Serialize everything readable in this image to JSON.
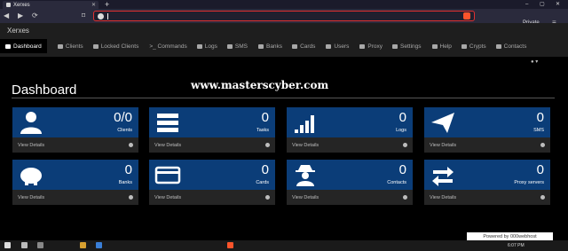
{
  "browser": {
    "tab_title": "Xerxes",
    "tab_close": "✕",
    "new_tab": "+",
    "nav": {
      "back": "◀",
      "forward": "▶",
      "reload": "⟳",
      "bookmark": "⌑"
    },
    "private_label": "Private",
    "menu": "≡",
    "window_controls": {
      "minimize": "–",
      "maximize": "▢",
      "close": "✕"
    }
  },
  "app": {
    "brand": "Xerxes",
    "nav_items": [
      {
        "label": "Dashboard",
        "icon": "dashboard-icon"
      },
      {
        "label": "Clients",
        "icon": "users-icon"
      },
      {
        "label": "Locked Clients",
        "icon": "lock-users-icon"
      },
      {
        "label": ">_ Commands",
        "icon": "terminal-icon"
      },
      {
        "label": "Logs",
        "icon": "logs-icon"
      },
      {
        "label": "SMS",
        "icon": "sms-icon"
      },
      {
        "label": "Banks",
        "icon": "bank-icon"
      },
      {
        "label": "Cards",
        "icon": "cards-icon"
      },
      {
        "label": "Users",
        "icon": "users-icon"
      },
      {
        "label": "Proxy",
        "icon": "proxy-icon"
      },
      {
        "label": "Settings",
        "icon": "gear-icon"
      },
      {
        "label": "Help",
        "icon": "help-icon"
      },
      {
        "label": "Crypts",
        "icon": "crypt-icon"
      },
      {
        "label": "Contacts",
        "icon": "contacts-icon"
      }
    ],
    "user_dropdown": "▾"
  },
  "page": {
    "title": "Dashboard",
    "watermark": "www.masterscyber.com"
  },
  "cards": [
    {
      "value": "0/0",
      "label": "Clients",
      "footer": "View Details",
      "icon": "user-icon"
    },
    {
      "value": "0",
      "label": "Tasks",
      "footer": "View Details",
      "icon": "tasks-icon"
    },
    {
      "value": "0",
      "label": "Logs",
      "footer": "View Details",
      "icon": "signal-bars-icon"
    },
    {
      "value": "0",
      "label": "SMS",
      "footer": "View Details",
      "icon": "paper-plane-icon"
    },
    {
      "value": "0",
      "label": "Banks",
      "footer": "View Details",
      "icon": "piggy-bank-icon"
    },
    {
      "value": "0",
      "label": "Cards",
      "footer": "View Details",
      "icon": "credit-card-icon"
    },
    {
      "value": "0",
      "label": "Contacts",
      "footer": "View Details",
      "icon": "spy-icon"
    },
    {
      "value": "0",
      "label": "Proxy servers",
      "footer": "View Details",
      "icon": "exchange-arrows-icon"
    }
  ],
  "footer_badge": "Powered by 000webhost",
  "taskbar": {
    "clock": "6:07 PM"
  },
  "colors": {
    "card_top": "#0b3d78",
    "card_bottom": "#252525",
    "accent_red": "#e03030"
  }
}
